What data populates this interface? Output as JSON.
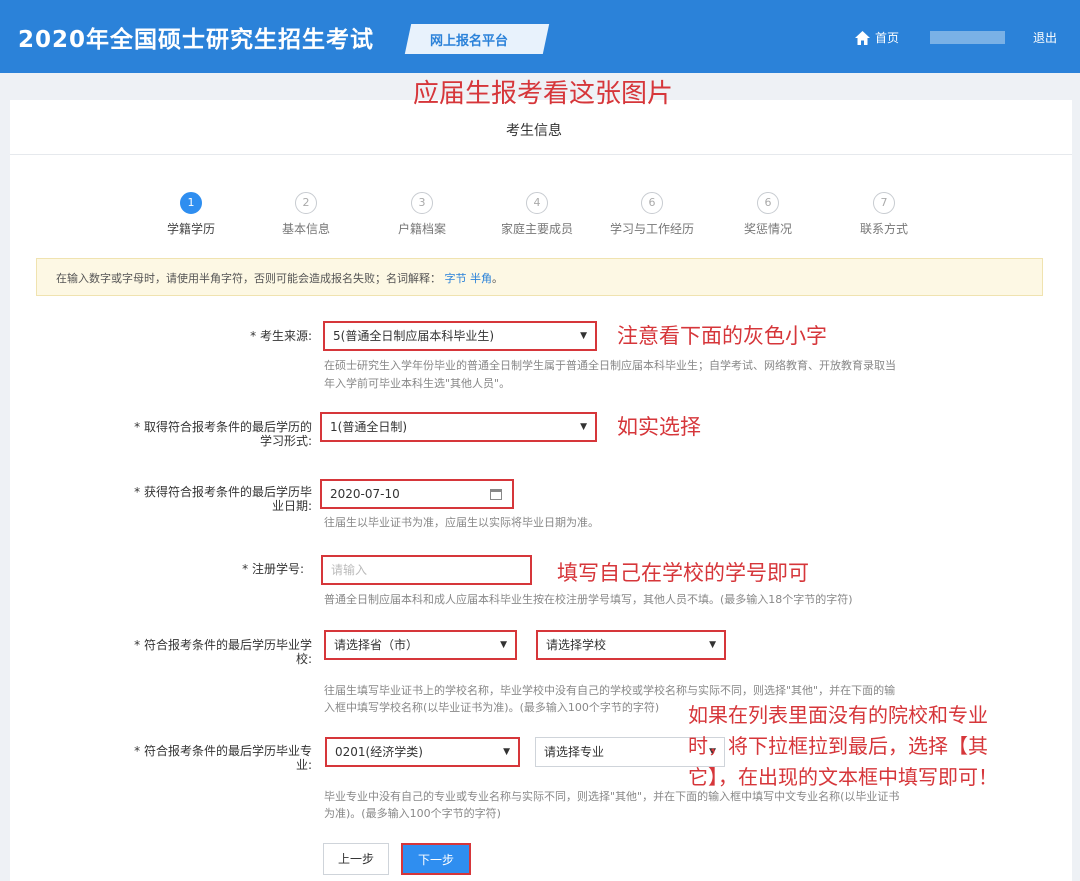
{
  "header": {
    "site_title": "2020年全国硕士研究生招生考试",
    "platform": "网上报名平台",
    "home": "首页",
    "logout": "退出"
  },
  "overlay_title": "应届生报考看这张图片",
  "panel_title": "考生信息",
  "steps": [
    {
      "num": "1",
      "label": "学籍学历"
    },
    {
      "num": "2",
      "label": "基本信息"
    },
    {
      "num": "3",
      "label": "户籍档案"
    },
    {
      "num": "4",
      "label": "家庭主要成员"
    },
    {
      "num": "6",
      "label": "学习与工作经历"
    },
    {
      "num": "6",
      "label": "奖惩情况"
    },
    {
      "num": "7",
      "label": "联系方式"
    }
  ],
  "notice": {
    "text": "在输入数字或字母时，请使用半角字符，否则可能会造成报名失败；名词解释：",
    "link1": "字节",
    "link2": "半角",
    "end": "。"
  },
  "form": {
    "source": {
      "label": "* 考生来源:",
      "value": "5(普通全日制应届本科毕业生)",
      "help1": "在硕士研究生入学年份毕业的普通全日制学生属于普通全日制应届本科毕业生；自学考试、网络教育、开放教育录取当",
      "help2": "年入学前可毕业本科生选\"其他人员\"。",
      "note": "注意看下面的灰色小字"
    },
    "study_form": {
      "label1": "* 取得符合报考条件的最后学历的",
      "label2": "学习形式:",
      "value": "1(普通全日制)",
      "note": "如实选择"
    },
    "grad_date": {
      "label1": "* 获得符合报考条件的最后学历毕",
      "label2": "业日期:",
      "value": "2020-07-10",
      "help": "往届生以毕业证书为准，应届生以实际将毕业日期为准。"
    },
    "student_id": {
      "label": "* 注册学号:",
      "placeholder": "请输入",
      "note": "填写自己在学校的学号即可",
      "help": "普通全日制应届本科和成人应届本科毕业生按在校注册学号填写，其他人员不填。(最多输入18个字节的字符)"
    },
    "school": {
      "label1": "* 符合报考条件的最后学历毕业学",
      "label2": "校:",
      "province": "请选择省（市）",
      "school": "请选择学校",
      "help1": "往届生填写毕业证书上的学校名称，毕业学校中没有自己的学校或学校名称与实际不同，则选择\"其他\"，并在下面的输",
      "help2": "入框中填写学校名称(以毕业证书为准)。(最多输入100个字节的字符)"
    },
    "major": {
      "label1": "* 符合报考条件的最后学历毕业专",
      "label2": "业:",
      "category": "0201(经济学类)",
      "major": "请选择专业",
      "help1": "毕业专业中没有自己的专业或专业名称与实际不同，则选择\"其他\"，并在下面的输入框中填写中文专业名称(以毕业证书",
      "help2": "为准)。(最多输入100个字节的字符)",
      "note1": "如果在列表里面没有的院校和专业",
      "note2": "时，将下拉框拉到最后，选择【其",
      "note3": "它】，在出现的文本框中填写即可！"
    }
  },
  "buttons": {
    "prev": "上一步",
    "next": "下一步"
  },
  "colors": {
    "header_bg": "#2b82d9",
    "active_step": "#2f8ef0",
    "annotation_red": "#d6363a",
    "notice_bg": "#fdf8e4"
  }
}
